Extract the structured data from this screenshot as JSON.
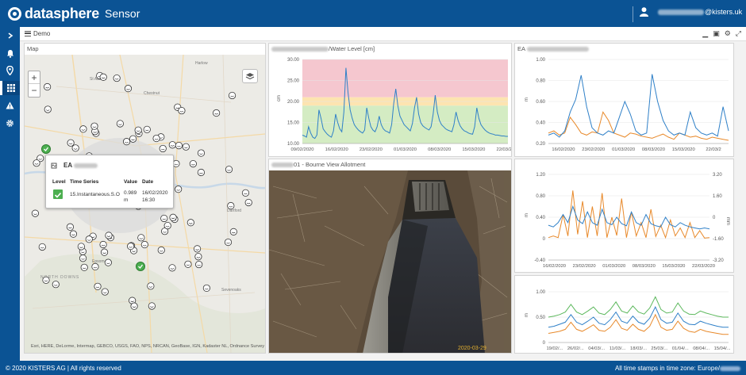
{
  "app": {
    "brand": "datasphere",
    "title": "Sensor"
  },
  "user": {
    "email_suffix": "@kisters.uk"
  },
  "dashboard": {
    "name": "Demo"
  },
  "map": {
    "title": "Map",
    "zoom_in": "+",
    "zoom_out": "−",
    "attribution": "Esri, HERE, DeLorme, Intermap, GEBCO, USGS, FAO, NPS, NRCAN, GeoBase, IGN, Kadaster NL, Ordnance Survey",
    "places": [
      "St Albans",
      "Harlow",
      "Chestnut",
      "Epsom",
      "Dartford",
      "Sevenoaks",
      "NORTH DOWNS"
    ],
    "popup": {
      "title_prefix": "EA",
      "headers": {
        "level": "Level",
        "series": "Time Series",
        "value": "Value",
        "date": "Date"
      },
      "row": {
        "series": "15.Instantaneous.S.O",
        "value": "0.989",
        "unit": "m",
        "date": "16/02/2020",
        "time": "16:30"
      }
    }
  },
  "chart_data": [
    {
      "type": "line",
      "title": "/Water Level [cm]",
      "ylabel": "cm",
      "ylim": [
        10,
        30
      ],
      "yticks": [
        "30.00",
        "25.00",
        "20.00",
        "15.00",
        "10.00"
      ],
      "categories": [
        "09/02/2020",
        "16/02/2020",
        "23/02/2020",
        "01/03/2020",
        "08/03/2020",
        "15/03/2020",
        "22/03/2020"
      ],
      "bands": [
        {
          "from": 21,
          "to": 30,
          "color": "#f5c7cf"
        },
        {
          "from": 19,
          "to": 21,
          "color": "#fde4b0"
        },
        {
          "from": 10,
          "to": 19,
          "color": "#d4ecc3"
        }
      ],
      "series": [
        {
          "color": "#2f80c8",
          "values": [
            12,
            11.8,
            11.5,
            14,
            12.5,
            11.5,
            11.2,
            12,
            18,
            16,
            13.5,
            12.8,
            12.2,
            11.8,
            11.5,
            13,
            17,
            15,
            13.5,
            12.8,
            17.5,
            28,
            22,
            18,
            16,
            14.5,
            13.8,
            13.2,
            12.8,
            12.5,
            13.2,
            18.5,
            16,
            14,
            13.2,
            12.8,
            14,
            16.5,
            14.5,
            13.5,
            13,
            12.8,
            12.5,
            14.5,
            19.5,
            23,
            19,
            16.5,
            15.5,
            14.5,
            14,
            13.5,
            13,
            14.8,
            18.5,
            21,
            17,
            15,
            14.2,
            13.8,
            13.5,
            13.2,
            14,
            17,
            21.5,
            17.5,
            15.5,
            14.5,
            14,
            13.5,
            13.2,
            13,
            12.8,
            14.5,
            17.5,
            15.5,
            14.2,
            13.5,
            13,
            12.8,
            12.5,
            12.3,
            12.2,
            14,
            18.5,
            16,
            14.5,
            13.8,
            13.2,
            12.8,
            12.5,
            12.3,
            12.2,
            12,
            12,
            11.9,
            11.8,
            11.8,
            11.7,
            11.7
          ]
        }
      ]
    },
    {
      "type": "line",
      "ylabel": "m",
      "ylim": [
        0.2,
        1.0
      ],
      "yticks": [
        "1.00",
        "0.80",
        "0.60",
        "0.40",
        "0.20"
      ],
      "categories": [
        "16/02/2020",
        "23/02/2020",
        "01/03/2020",
        "08/03/2020",
        "15/03/2020",
        "22/03/2"
      ],
      "series": [
        {
          "color": "#e8892a",
          "values": [
            0.3,
            0.32,
            0.28,
            0.3,
            0.45,
            0.38,
            0.3,
            0.28,
            0.31,
            0.3,
            0.5,
            0.42,
            0.3,
            0.28,
            0.26,
            0.3,
            0.29,
            0.27,
            0.26,
            0.25,
            0.27,
            0.29,
            0.26,
            0.24,
            0.3,
            0.28,
            0.26,
            0.27,
            0.25,
            0.24,
            0.26,
            0.25,
            0.24,
            0.23
          ]
        },
        {
          "color": "#2f80c8",
          "values": [
            0.28,
            0.3,
            0.26,
            0.32,
            0.5,
            0.62,
            0.85,
            0.55,
            0.35,
            0.3,
            0.28,
            0.32,
            0.3,
            0.45,
            0.6,
            0.48,
            0.32,
            0.28,
            0.3,
            0.86,
            0.6,
            0.42,
            0.32,
            0.28,
            0.3,
            0.28,
            0.5,
            0.35,
            0.3,
            0.28,
            0.3,
            0.27,
            0.55,
            0.32
          ]
        }
      ]
    },
    {
      "type": "line",
      "ylabel": "m",
      "y2label": "mm",
      "ylim": [
        -0.4,
        1.2
      ],
      "yticks": [
        "1.20",
        "0.80",
        "0.40",
        "0",
        "-0.40"
      ],
      "y2ticks": [
        "3.20",
        "1.60",
        "0",
        "-1.60",
        "-3.20"
      ],
      "categories": [
        "16/02/2020",
        "23/02/2020",
        "01/03/2020",
        "08/03/2020",
        "15/03/2020",
        "22/03/2020"
      ],
      "series": [
        {
          "color": "#e8892a",
          "values": [
            0.02,
            0.05,
            0.02,
            0.45,
            0.05,
            0.9,
            0.08,
            0.7,
            0.02,
            0.6,
            0.05,
            0.85,
            0.02,
            0.4,
            0.06,
            0.75,
            0.02,
            0.5,
            0.05,
            0.3,
            0.02,
            0.55,
            0.04,
            0.25,
            0.02,
            0.35,
            0.05,
            0.2,
            0.02,
            0.3,
            0.02,
            0.15,
            0.01,
            0.02
          ]
        },
        {
          "color": "#2f80c8",
          "values": [
            0.25,
            0.22,
            0.3,
            0.45,
            0.3,
            0.6,
            0.35,
            0.28,
            0.5,
            0.3,
            0.25,
            0.55,
            0.3,
            0.26,
            0.4,
            0.28,
            0.24,
            0.5,
            0.3,
            0.25,
            0.45,
            0.28,
            0.24,
            0.22,
            0.4,
            0.26,
            0.22,
            0.3,
            0.25,
            0.22,
            0.2,
            0.18,
            0.2,
            0.18
          ]
        }
      ]
    },
    {
      "type": "line",
      "ylabel": "m",
      "ylim": [
        0,
        1.0
      ],
      "yticks": [
        "1.00",
        "0.50",
        "0"
      ],
      "categories": [
        "19/02/...",
        "26/02/...",
        "04/03/...",
        "11/03/...",
        "18/03/...",
        "25/03/...",
        "01/04/...",
        "08/04/...",
        "15/04/..."
      ],
      "series": [
        {
          "color": "#5cb85c",
          "values": [
            0.5,
            0.52,
            0.55,
            0.6,
            0.75,
            0.6,
            0.55,
            0.62,
            0.7,
            0.58,
            0.55,
            0.65,
            0.8,
            0.62,
            0.58,
            0.72,
            0.6,
            0.56,
            0.68,
            0.9,
            0.65,
            0.58,
            0.6,
            0.78,
            0.62,
            0.56,
            0.55,
            0.62,
            0.58,
            0.55,
            0.52,
            0.5,
            0.5
          ]
        },
        {
          "color": "#2f80c8",
          "values": [
            0.3,
            0.32,
            0.36,
            0.4,
            0.55,
            0.4,
            0.35,
            0.42,
            0.5,
            0.38,
            0.35,
            0.45,
            0.6,
            0.42,
            0.38,
            0.52,
            0.4,
            0.36,
            0.48,
            0.7,
            0.45,
            0.38,
            0.4,
            0.58,
            0.42,
            0.36,
            0.35,
            0.42,
            0.38,
            0.35,
            0.32,
            0.3,
            0.3
          ]
        },
        {
          "color": "#e8892a",
          "values": [
            0.18,
            0.2,
            0.22,
            0.26,
            0.4,
            0.26,
            0.22,
            0.28,
            0.35,
            0.24,
            0.22,
            0.3,
            0.45,
            0.28,
            0.24,
            0.36,
            0.26,
            0.22,
            0.32,
            0.55,
            0.3,
            0.24,
            0.26,
            0.42,
            0.28,
            0.22,
            0.2,
            0.26,
            0.22,
            0.2,
            0.18,
            0.16,
            0.16
          ]
        }
      ]
    }
  ],
  "panels": {
    "wl_title": "/Water Level [cm]",
    "ea1_title": "EA",
    "photo_title": "01 - Bourne View Allotment",
    "photo_timestamp": "2020-03-29"
  },
  "footer": {
    "copyright": "© 2020 KISTERS AG | All rights reserved",
    "tz": "All time stamps in time zone: Europe/"
  }
}
